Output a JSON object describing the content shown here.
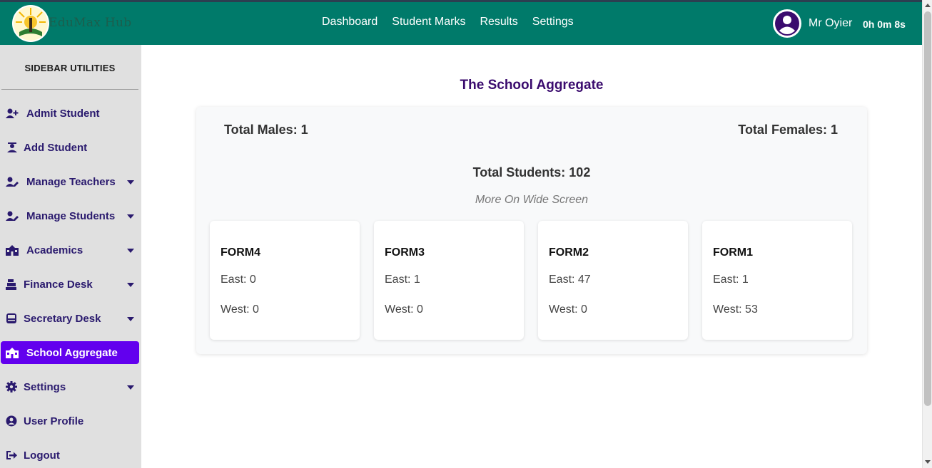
{
  "header": {
    "brand": "EduMax Hub",
    "nav": [
      "Dashboard",
      "Student Marks",
      "Results",
      "Settings"
    ],
    "user_name": "Mr Oyier",
    "timer": "0h 0m 8s"
  },
  "sidebar": {
    "title": "SIDEBAR UTILITIES",
    "items": [
      {
        "label": "Admit Student",
        "icon": "user-plus-icon",
        "dropdown": false
      },
      {
        "label": "Add Student",
        "icon": "graduate-icon",
        "dropdown": false
      },
      {
        "label": "Manage Teachers",
        "icon": "user-edit-icon",
        "dropdown": true
      },
      {
        "label": "Manage Students",
        "icon": "user-edit-icon",
        "dropdown": true
      },
      {
        "label": "Academics",
        "icon": "school-icon",
        "dropdown": true
      },
      {
        "label": "Finance Desk",
        "icon": "cash-register-icon",
        "dropdown": true
      },
      {
        "label": "Secretary Desk",
        "icon": "inbox-icon",
        "dropdown": true
      },
      {
        "label": "School Aggregate",
        "icon": "school-icon",
        "dropdown": false,
        "active": true
      },
      {
        "label": "Settings",
        "icon": "gear-icon",
        "dropdown": true
      },
      {
        "label": "User Profile",
        "icon": "user-circle-icon",
        "dropdown": false
      },
      {
        "label": "Logout",
        "icon": "sign-out-icon",
        "dropdown": false
      }
    ]
  },
  "main": {
    "title": "The School Aggregate",
    "total_males": "Total Males: 1",
    "total_females": "Total Females: 1",
    "total_students": "Total Students: 102",
    "note": "More On Wide Screen",
    "forms": [
      {
        "name": "FORM4",
        "east": "East: 0",
        "west": "West: 0"
      },
      {
        "name": "FORM3",
        "east": "East: 1",
        "west": "West: 0"
      },
      {
        "name": "FORM2",
        "east": "East: 47",
        "west": "West: 0"
      },
      {
        "name": "FORM1",
        "east": "East: 1",
        "west": "West: 53"
      }
    ]
  },
  "colors": {
    "header_bg": "#007a6a",
    "sidebar_bg": "#e0e0e0",
    "active_item": "#6200ee",
    "sidebar_text": "#2a1a6e",
    "title_text": "#3a0b6e"
  }
}
